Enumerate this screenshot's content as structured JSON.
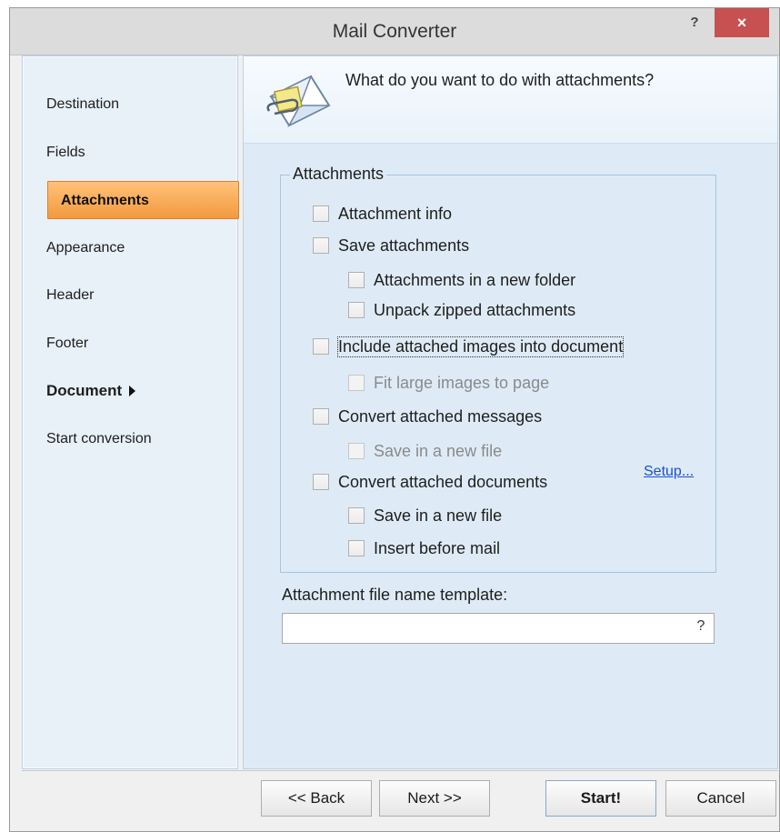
{
  "window": {
    "title": "Mail Converter",
    "help_glyph": "?",
    "close_glyph": "×"
  },
  "sidebar": {
    "items": [
      {
        "label": "Destination"
      },
      {
        "label": "Fields"
      },
      {
        "label": "Attachments",
        "active": true
      },
      {
        "label": "Appearance"
      },
      {
        "label": "Header"
      },
      {
        "label": "Footer"
      },
      {
        "label": "Document",
        "has_submenu": true
      },
      {
        "label": "Start conversion"
      }
    ]
  },
  "header": {
    "question": "What do you want to do with attachments?",
    "icon": "mail-attachment-icon"
  },
  "attachments_group": {
    "title": "Attachments",
    "options": [
      {
        "label": "Attachment info",
        "checked": false,
        "enabled": true
      },
      {
        "label": "Save attachments",
        "checked": false,
        "enabled": true
      },
      {
        "label": "Attachments in a new folder",
        "checked": false,
        "enabled": true
      },
      {
        "label": "Unpack zipped attachments",
        "checked": false,
        "enabled": true
      },
      {
        "label": "Include attached images into document",
        "checked": false,
        "enabled": true,
        "focused": true
      },
      {
        "label": "Fit large images to page",
        "checked": false,
        "enabled": false
      },
      {
        "label": "Convert attached messages",
        "checked": false,
        "enabled": true
      },
      {
        "label": "Save in a new file",
        "checked": false,
        "enabled": false
      },
      {
        "label": "Convert attached documents",
        "checked": false,
        "enabled": true
      },
      {
        "label": "Save in a new file",
        "checked": false,
        "enabled": true
      },
      {
        "label": "Insert before mail",
        "checked": false,
        "enabled": true
      }
    ],
    "setup_link": "Setup..."
  },
  "template": {
    "label": "Attachment file name template:",
    "value": "",
    "help_glyph": "?"
  },
  "buttons": {
    "back": "<< Back",
    "next": "Next >>",
    "start": "Start!",
    "cancel": "Cancel"
  },
  "colors": {
    "active_nav": "#f29a3e",
    "close_button": "#c75050",
    "link": "#1c4fd6"
  }
}
